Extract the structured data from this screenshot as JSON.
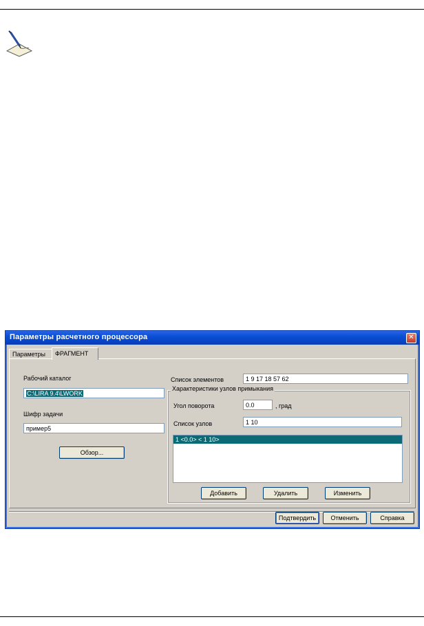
{
  "dialog": {
    "title": "Параметры расчетного процессора",
    "tabs": [
      {
        "label": "Параметры"
      },
      {
        "label": "ФРАГМЕНТ"
      }
    ],
    "work_dir": {
      "label": "Рабочий каталог",
      "value": "C:\\LIRA 9.4\\LWORK"
    },
    "task_code": {
      "label": "Шифр задачи",
      "value": "пример5"
    },
    "browse_label": "Обзор...",
    "elements": {
      "label": "Список элементов",
      "value": "1 9 17 18 57 62"
    },
    "group_title": "Характеристики узлов примыкания",
    "rotation": {
      "label": "Угол поворота",
      "value": "0.0",
      "unit": ", град"
    },
    "nodes": {
      "label": "Список узлов",
      "value": "1 10"
    },
    "list_items": [
      "1  <0.0>  < 1 10>"
    ],
    "add_label": "Добавить",
    "delete_label": "Удалить",
    "edit_label": "Изменить",
    "confirm_label": "Подтвердить",
    "cancel_label": "Отменить",
    "help_label": "Справка"
  },
  "icons": [
    "pen-note-icon",
    "close-icon"
  ],
  "colors": {
    "titlebar": "#0a4fd4",
    "selection": "#0a6b76",
    "dialog_bg": "#d4d0c8"
  }
}
